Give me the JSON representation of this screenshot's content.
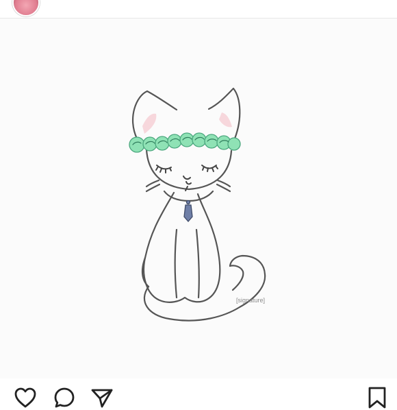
{
  "header": {
    "avatar": "profile-avatar"
  },
  "post": {
    "image": "cat-with-flower-crown-drawing",
    "artist_signature": "[signature]"
  },
  "actions": {
    "like": "heart-icon",
    "comment": "comment-icon",
    "share": "paper-plane-icon",
    "save": "bookmark-icon"
  },
  "colors": {
    "crown_green": "#6fcf9c",
    "ear_pink": "#f4c9cf",
    "line": "#555555",
    "pendant": "#6f7fa7"
  }
}
